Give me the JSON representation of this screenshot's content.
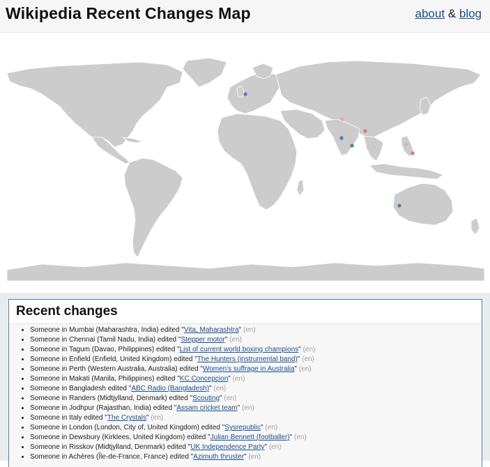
{
  "header": {
    "title": "Wikipedia Recent Changes Map",
    "about_label": "about",
    "amp": "&",
    "blog_label": "blog"
  },
  "map": {
    "land_color": "#cccccc",
    "border_color": "#ffffff",
    "dot_colors": {
      "blue": "#4a7fb0",
      "red": "#d9776a"
    }
  },
  "recent": {
    "heading": "Recent changes",
    "items": [
      {
        "who": "Someone in Mumbai (Maharashtra, India) edited \"",
        "article": "Vita, Maharashtra",
        "tail": "\"",
        "lang": "(en)"
      },
      {
        "who": "Someone in Chennai (Tamil Nadu, India) edited \"",
        "article": "Stepper motor",
        "tail": "\"",
        "lang": "(en)"
      },
      {
        "who": "Someone in Tagum (Davao, Philippines) edited \"",
        "article": "List of current world boxing champions",
        "tail": "\"",
        "lang": "(en)"
      },
      {
        "who": "Someone in Enfield (Enfield, United Kingdom) edited \"",
        "article": "The Hunters (instrumental band)",
        "tail": "\"",
        "lang": "(en)"
      },
      {
        "who": "Someone in Perth (Western Australia, Australia) edited \"",
        "article": "Women's suffrage in Australia",
        "tail": "\"",
        "lang": "(en)"
      },
      {
        "who": "Someone in Makati (Manila, Philippines) edited \"",
        "article": "KC Concepcion",
        "tail": "\"",
        "lang": "(en)"
      },
      {
        "who": "Someone in Bangladesh edited \"",
        "article": "ABC Radio (Bangladesh)",
        "tail": "\"",
        "lang": "(en)"
      },
      {
        "who": "Someone in Randers (Midtjylland, Denmark) edited \"",
        "article": "Scouting",
        "tail": "\"",
        "lang": "(en)"
      },
      {
        "who": "Someone in Jodhpur (Rajasthan, India) edited \"",
        "article": "Assam cricket team",
        "tail": "\"",
        "lang": "(en)"
      },
      {
        "who": "Someone in Italy edited \"",
        "article": "The Crystals",
        "tail": "\"",
        "lang": "(en)"
      },
      {
        "who": "Someone in London (London, City of, United Kingdom) edited \"",
        "article": "Sysrepublic",
        "tail": "\"",
        "lang": "(en)"
      },
      {
        "who": "Someone in Dewsbury (Kirklees, United Kingdom) edited \"",
        "article": "Julian Bennett (footballer)",
        "tail": "\"",
        "lang": "(en)"
      },
      {
        "who": "Someone in Risskov (Midtjylland, Denmark) edited \"",
        "article": "UK Independence Party",
        "tail": "\"",
        "lang": "(en)"
      },
      {
        "who": "Someone in Achères (Île-de-France, France) edited \"",
        "article": "Azimuth thruster",
        "tail": "\"",
        "lang": "(en)"
      }
    ]
  }
}
